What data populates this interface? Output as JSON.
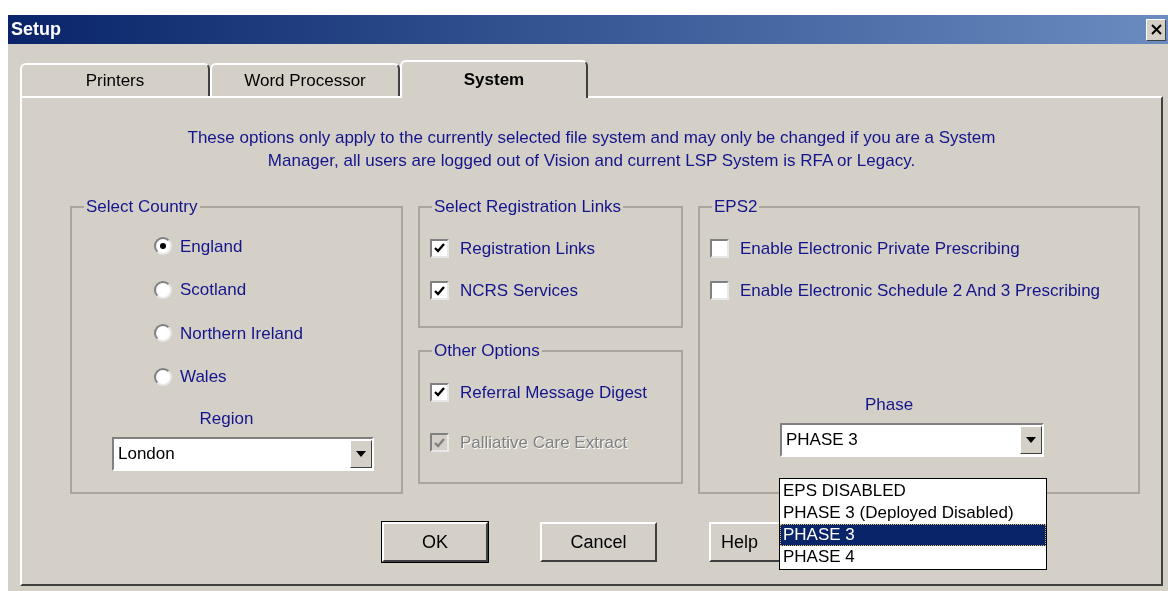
{
  "window": {
    "title": "Setup"
  },
  "tabs": [
    {
      "label": "Printers",
      "selected": false
    },
    {
      "label": "Word Processor",
      "selected": false
    },
    {
      "label": "System",
      "selected": true
    }
  ],
  "notice": "These options only apply to the currently selected file system and may only be changed if you are a System Manager, all users are logged out of Vision and current LSP System is RFA or Legacy.",
  "select_country": {
    "title": "Select Country",
    "options": [
      {
        "label": "England",
        "selected": true
      },
      {
        "label": "Scotland",
        "selected": false
      },
      {
        "label": "Northern Ireland",
        "selected": false
      },
      {
        "label": "Wales",
        "selected": false
      }
    ],
    "region_label": "Region",
    "region_value": "London"
  },
  "registration_links": {
    "title": "Select Registration Links",
    "items": [
      {
        "label": "Registration Links",
        "checked": true,
        "disabled": false
      },
      {
        "label": "NCRS Services",
        "checked": true,
        "disabled": false
      }
    ]
  },
  "other_options": {
    "title": "Other Options",
    "items": [
      {
        "label": "Referral Message Digest",
        "checked": true,
        "disabled": false
      },
      {
        "label": "Palliative Care Extract",
        "checked": true,
        "disabled": true
      }
    ]
  },
  "eps2": {
    "title": "EPS2",
    "items": [
      {
        "label": "Enable Electronic Private Prescribing",
        "checked": false,
        "disabled": false
      },
      {
        "label": "Enable Electronic Schedule 2 And 3 Prescribing",
        "checked": false,
        "disabled": false
      }
    ],
    "phase_label": "Phase",
    "phase_value": "PHASE 3",
    "phase_options": [
      {
        "label": "EPS DISABLED",
        "selected": false
      },
      {
        "label": "PHASE 3 (Deployed Disabled)",
        "selected": false
      },
      {
        "label": "PHASE 3",
        "selected": true
      },
      {
        "label": "PHASE 4",
        "selected": false
      }
    ]
  },
  "buttons": [
    {
      "label": "OK",
      "default": true
    },
    {
      "label": "Cancel",
      "default": false
    },
    {
      "label": "Help",
      "default": false
    }
  ]
}
